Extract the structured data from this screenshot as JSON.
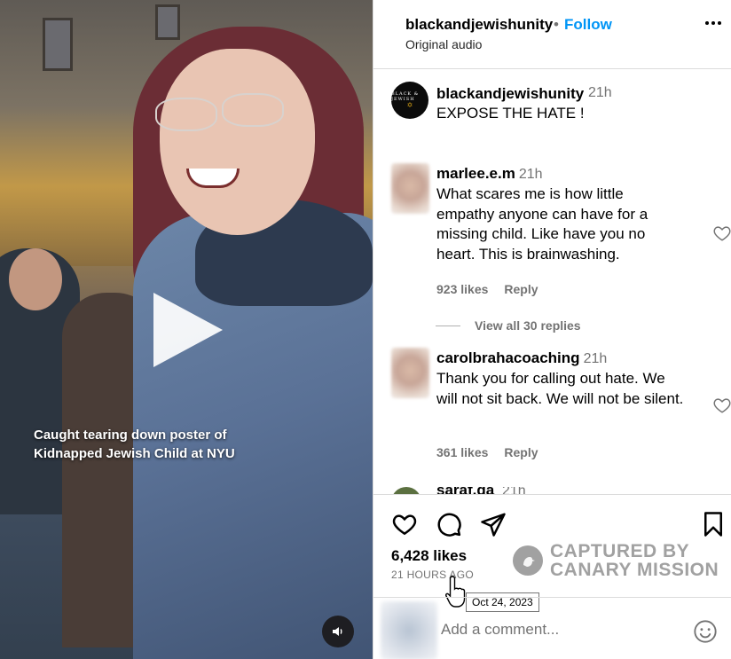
{
  "video": {
    "caption_line1": "Caught tearing down  poster of",
    "caption_line2": "Kidnapped Jewish Child at NYU"
  },
  "header": {
    "username": "blackandjewishunity",
    "separator": "•",
    "follow_label": "Follow",
    "audio": "Original audio"
  },
  "post": {
    "logo_text": "BLACK & JEWISH",
    "username": "blackandjewishunity",
    "time": "21h",
    "caption": "EXPOSE THE HATE !"
  },
  "comments": [
    {
      "username": "marlee.e.m",
      "time": "21h",
      "text": "What scares me is how little empathy anyone can have for a missing child. Like have you no heart. This is brainwashing.",
      "likes": "923 likes",
      "reply": "Reply"
    },
    {
      "username": "carolbrahacoaching",
      "time": "21h",
      "text": "Thank you for calling out hate. We will not sit back. We will not be silent.",
      "likes": "361 likes",
      "reply": "Reply"
    }
  ],
  "view_replies": "View all 30 replies",
  "peek_comment": {
    "username": "saraf.da",
    "time": "21h"
  },
  "stats": {
    "likes": "6,428 likes",
    "ago": "21 HOURS AGO",
    "tooltip": "Oct 24, 2023"
  },
  "watermark": {
    "line1": "CAPTURED BY",
    "line2": "CANARY MISSION"
  },
  "add_comment": {
    "placeholder": "Add a comment..."
  },
  "colors": {
    "accent": "#0095f6",
    "secondary_text": "#737373",
    "border": "#dbdbdb"
  },
  "icons": [
    "play-icon",
    "volume-icon",
    "more-icon",
    "heart-icon",
    "comment-icon",
    "share-icon",
    "bookmark-icon",
    "emoji-icon",
    "canary-icon",
    "hand-cursor-icon"
  ]
}
